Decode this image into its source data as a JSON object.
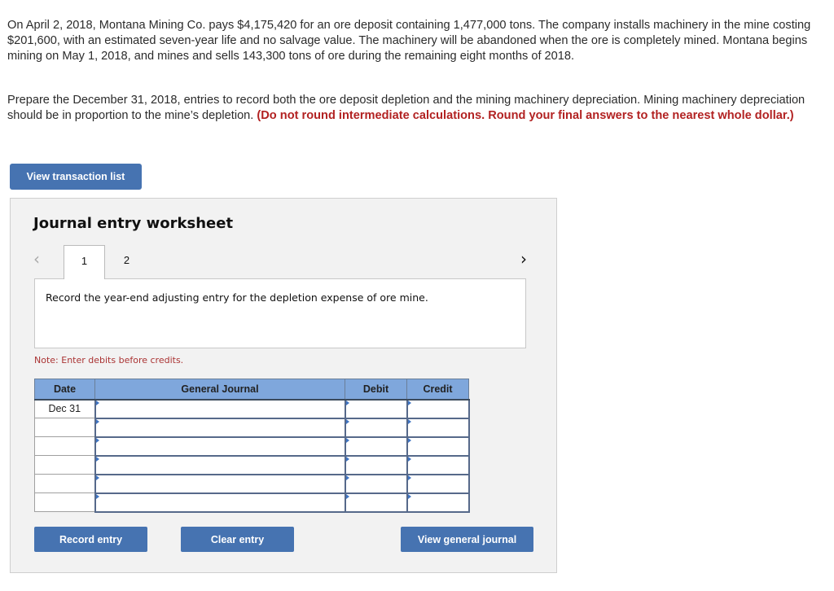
{
  "problem": {
    "paragraph1": "On April 2, 2018, Montana Mining Co. pays $4,175,420 for an ore deposit containing 1,477,000 tons. The company installs machinery in the mine costing $201,600, with an estimated seven-year life and no salvage value. The machinery will be abandoned when the ore is completely mined. Montana begins mining on May 1, 2018, and mines and sells 143,300 tons of ore during the remaining eight months of 2018.",
    "paragraph2_normal": "Prepare the December 31, 2018, entries to record both the ore deposit depletion and the mining machinery depreciation. Mining machinery depreciation should be in proportion to the mine’s depletion. ",
    "paragraph2_emphasis": "(Do not round intermediate calculations. Round your final answers to the nearest whole dollar.)"
  },
  "buttons": {
    "view_transaction_list": "View transaction list",
    "record_entry": "Record entry",
    "clear_entry": "Clear entry",
    "view_general_journal": "View general journal"
  },
  "worksheet": {
    "title": "Journal entry worksheet",
    "prev_icon": "‹",
    "next_icon": "›",
    "tabs": [
      {
        "label": "1",
        "active": true
      },
      {
        "label": "2",
        "active": false
      }
    ],
    "instruction": "Record the year-end adjusting entry for the depletion expense of ore mine.",
    "note": "Note: Enter debits before credits."
  },
  "journal_table": {
    "headers": {
      "date": "Date",
      "general_journal": "General Journal",
      "debit": "Debit",
      "credit": "Credit"
    },
    "rows": [
      {
        "date": "Dec 31",
        "account": "",
        "debit": "",
        "credit": ""
      },
      {
        "date": "",
        "account": "",
        "debit": "",
        "credit": ""
      },
      {
        "date": "",
        "account": "",
        "debit": "",
        "credit": ""
      },
      {
        "date": "",
        "account": "",
        "debit": "",
        "credit": ""
      },
      {
        "date": "",
        "account": "",
        "debit": "",
        "credit": ""
      },
      {
        "date": "",
        "account": "",
        "debit": "",
        "credit": ""
      }
    ]
  },
  "colors": {
    "button_blue": "#4673b1",
    "header_blue": "#7fa7dc",
    "emphasis_red": "#b22222",
    "note_red": "#a33333"
  }
}
